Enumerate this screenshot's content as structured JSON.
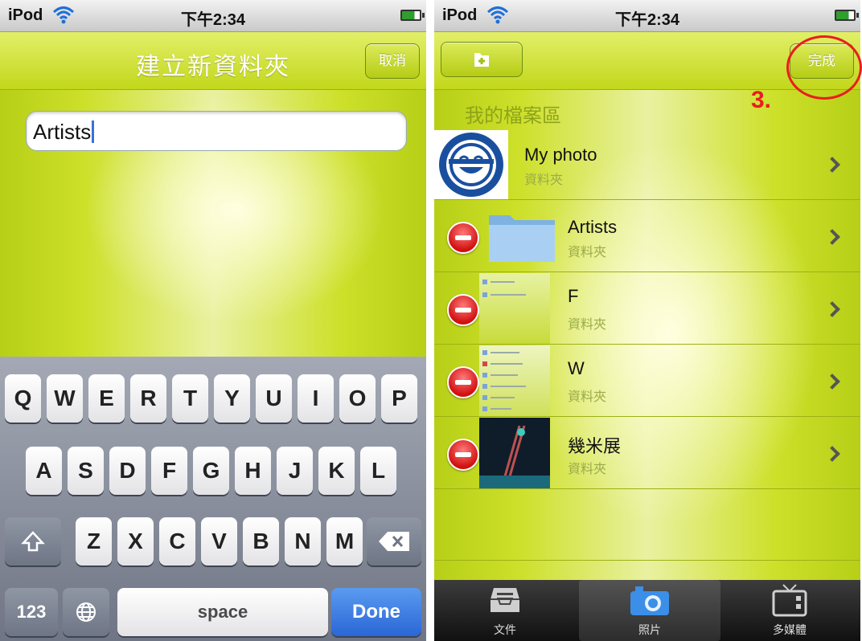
{
  "status": {
    "carrier": "iPod",
    "time": "下午2:34"
  },
  "left": {
    "nav_title": "建立新資料夾",
    "cancel_label": "取消",
    "input_value": "Artists",
    "keyboard": {
      "row1": [
        "Q",
        "W",
        "E",
        "R",
        "T",
        "Y",
        "U",
        "I",
        "O",
        "P"
      ],
      "row2": [
        "A",
        "S",
        "D",
        "F",
        "G",
        "H",
        "J",
        "K",
        "L"
      ],
      "row3": [
        "Z",
        "X",
        "C",
        "V",
        "B",
        "N",
        "M"
      ],
      "numbers_label": "123",
      "space_label": "space",
      "done_label": "Done"
    }
  },
  "right": {
    "done_label": "完成",
    "annotation": "3.",
    "section_header": "我的檔案區",
    "items": [
      {
        "title": "My photo",
        "subtitle": "資料夾"
      },
      {
        "title": "Artists",
        "subtitle": "資料夾"
      },
      {
        "title": "F",
        "subtitle": "資料夾"
      },
      {
        "title": "W",
        "subtitle": "資料夾"
      },
      {
        "title": "幾米展",
        "subtitle": "資料夾"
      }
    ],
    "tabs": [
      {
        "label": "文件",
        "icon": "inbox-tray-icon"
      },
      {
        "label": "照片",
        "icon": "camera-icon"
      },
      {
        "label": "多媒體",
        "icon": "tv-icon"
      }
    ]
  },
  "colors": {
    "accent_green": "#c2d71b",
    "annotation_red": "#e81e1e",
    "done_blue": "#2a66d6"
  }
}
